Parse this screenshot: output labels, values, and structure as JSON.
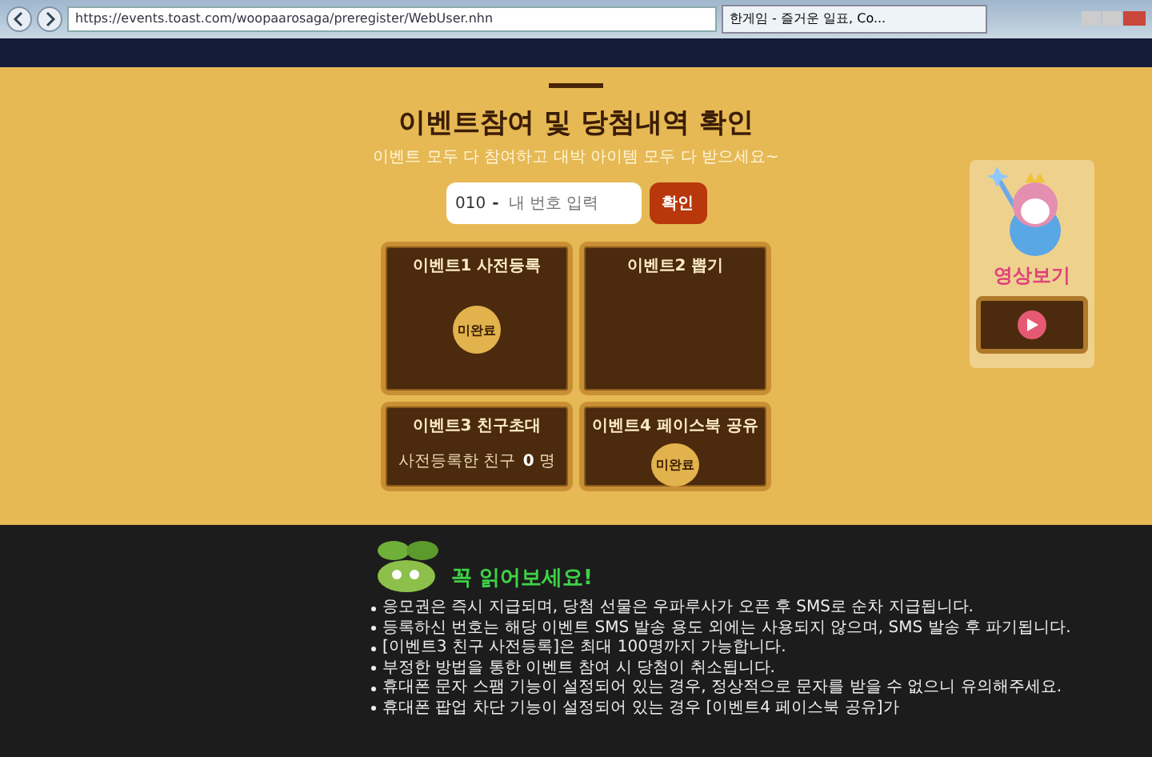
{
  "browser": {
    "url": "https://events.toast.com/woopaarosaga/preregister/WebUser.nhn",
    "tab_title": "한게임 - 즐거운 일표, Co..."
  },
  "header": {
    "title": "이벤트참여 및 당첨내역 확인",
    "subtitle": "이벤트 모두 다 참여하고 대박 아이템 모두 다 받으세요~"
  },
  "phone_form": {
    "prefix": "010",
    "separator": "-",
    "placeholder": "내 번호 입력",
    "button": "확인"
  },
  "events": [
    {
      "kind": "badge",
      "title": "이벤트1 사전등록",
      "badge": "미완료"
    },
    {
      "kind": "empty",
      "title": "이벤트2 뽑기"
    },
    {
      "kind": "count",
      "title": "이벤트3 친구초대",
      "label": "사전등록한 친구",
      "count": "0",
      "unit": "명"
    },
    {
      "kind": "badge",
      "title": "이벤트4 페이스북 공유",
      "badge": "미완료"
    }
  ],
  "video": {
    "label": "영상보기"
  },
  "notice": {
    "title": "꼭 읽어보세요!",
    "items": [
      "응모권은 즉시 지급되며, 당첨 선물은 우파루사가 오픈 후 SMS로 순차 지급됩니다.",
      "등록하신 번호는 해당 이벤트 SMS 발송 용도 외에는 사용되지 않으며, SMS 발송 후 파기됩니다.",
      "[이벤트3 친구 사전등록]은 최대 100명까지 가능합니다.",
      "부정한 방법을 통한 이벤트 참여 시 당첨이 취소됩니다.",
      "휴대폰 문자 스팸 기능이 설정되어 있는 경우, 정상적으로 문자를 받을 수 없으니 유의해주세요.",
      "휴대폰 팝업 차단 기능이 설정되어 있는 경우 [이벤트4 페이스북 공유]가"
    ]
  }
}
